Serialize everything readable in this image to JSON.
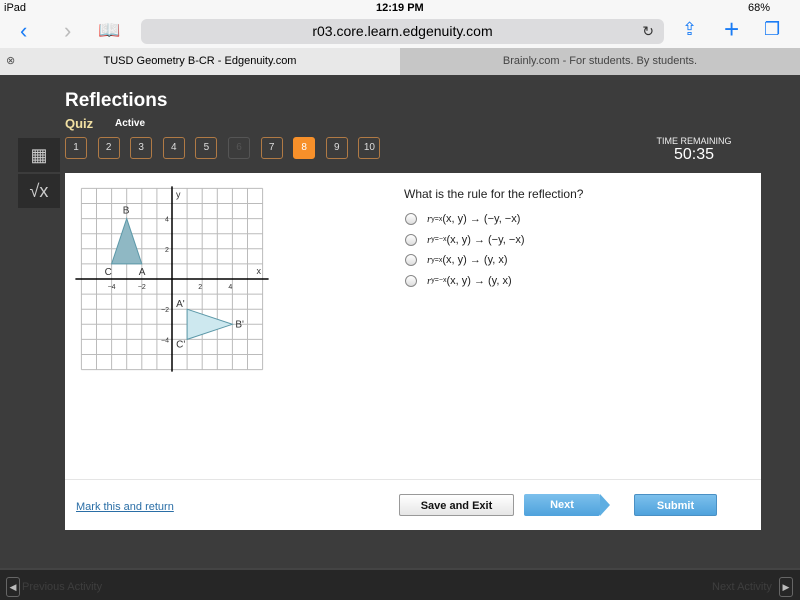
{
  "status": {
    "device": "iPad",
    "time": "12:19 PM",
    "battery": "68%"
  },
  "browser": {
    "url": "r03.core.learn.edgenuity.com",
    "tabs": [
      {
        "label": "TUSD Geometry B-CR - Edgenuity.com"
      },
      {
        "label": "Brainly.com - For students. By students."
      }
    ]
  },
  "header": {
    "title": "Reflections",
    "type": "Quiz",
    "state": "Active",
    "timer_label": "TIME REMAINING",
    "timer": "50:35"
  },
  "questions": [
    {
      "n": "1"
    },
    {
      "n": "2"
    },
    {
      "n": "3"
    },
    {
      "n": "4"
    },
    {
      "n": "5"
    },
    {
      "n": "6",
      "disabled": true
    },
    {
      "n": "7"
    },
    {
      "n": "8",
      "current": true
    },
    {
      "n": "9"
    },
    {
      "n": "10"
    }
  ],
  "question": {
    "text": "What is the rule for the reflection?",
    "options": [
      {
        "r": "r",
        "sub": "y=x",
        "map": "(x, y) → (−y, −x)"
      },
      {
        "r": "r",
        "sub": "y=−x",
        "map": "(x, y) → (−y, −x)"
      },
      {
        "r": "r",
        "sub": "y=x",
        "map": "(x, y) → (y, x)"
      },
      {
        "r": "r",
        "sub": "y=−x",
        "map": "(x, y) → (y, x)"
      }
    ]
  },
  "graph": {
    "xlabel": "x",
    "ylabel": "y",
    "range": [
      -6,
      6
    ],
    "ticks_x": [
      "−4",
      "−2",
      "2",
      "4"
    ],
    "ticks_y": [
      "4",
      "2",
      "−2",
      "−4"
    ],
    "pre": {
      "color": "#8fb8c4",
      "points": [
        {
          "label": "A",
          "x": -2,
          "y": 1
        },
        {
          "label": "B",
          "x": -3,
          "y": 4
        },
        {
          "label": "C",
          "x": -4,
          "y": 1
        }
      ]
    },
    "image": {
      "color": "#cde8ef",
      "points": [
        {
          "label": "A'",
          "x": 1,
          "y": -2
        },
        {
          "label": "B'",
          "x": 4,
          "y": -3
        },
        {
          "label": "C'",
          "x": 1,
          "y": -4
        }
      ]
    }
  },
  "actions": {
    "mark": "Mark this and return",
    "save": "Save and Exit",
    "next": "Next",
    "submit": "Submit"
  },
  "footer": {
    "prev": "Previous Activity",
    "next": "Next Activity"
  }
}
